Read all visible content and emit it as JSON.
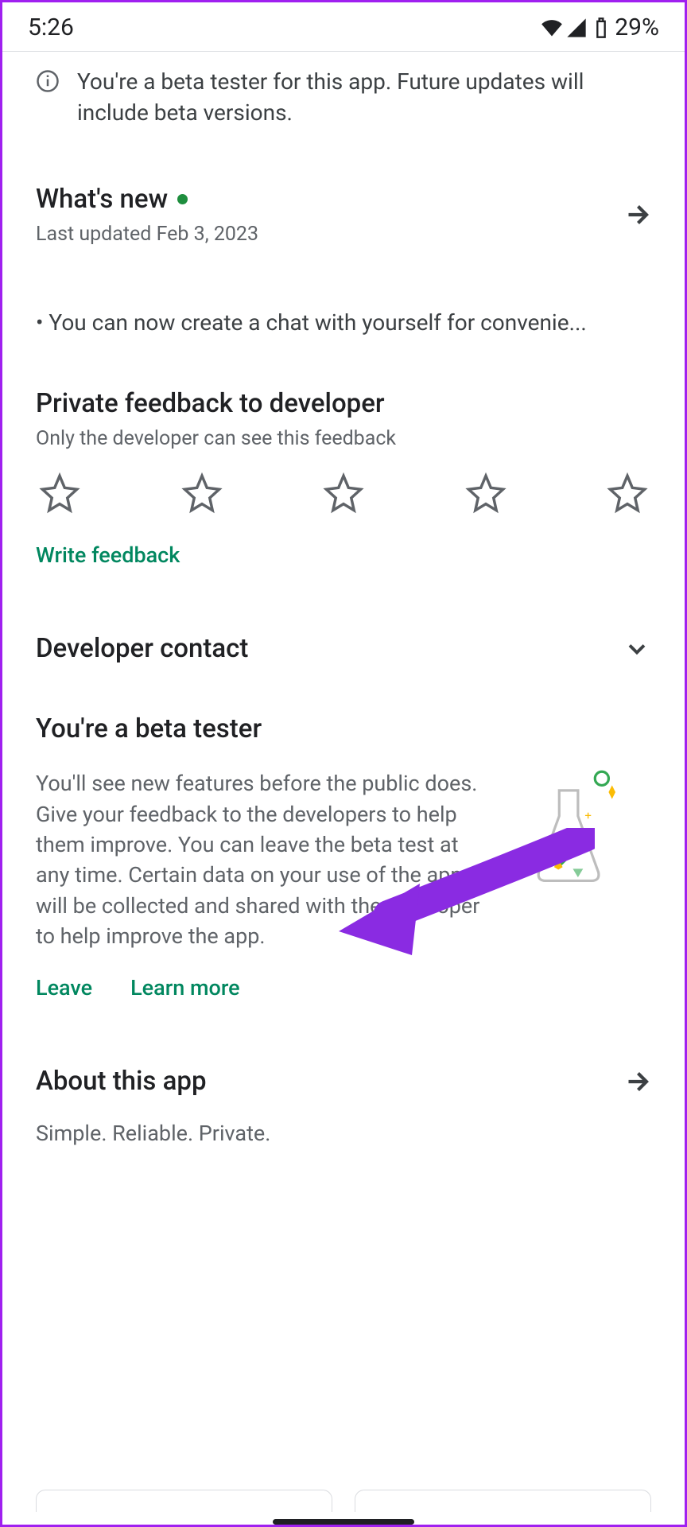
{
  "statusbar": {
    "time": "5:26",
    "battery": "29%"
  },
  "beta_banner": "You're a beta tester for this app. Future updates will include beta versions.",
  "whats_new": {
    "title": "What's new",
    "updated": "Last updated Feb 3, 2023",
    "body": "• You can now create a chat with yourself for convenie..."
  },
  "feedback": {
    "title": "Private feedback to developer",
    "subtitle": "Only the developer can see this feedback",
    "write": "Write feedback"
  },
  "developer_contact": {
    "title": "Developer contact"
  },
  "beta_tester": {
    "title": "You're a beta tester",
    "description": "You'll see new features before the public does. Give your feedback to the developers to help them improve. You can leave the beta test at any time. Certain data on your use of the app will be collected and shared with the developer to help improve the app.",
    "leave": "Leave",
    "learn_more": "Learn more"
  },
  "about": {
    "title": "About this app",
    "description": "Simple. Reliable. Private."
  },
  "colors": {
    "accent": "#01875f",
    "annotation": "#8a2be2"
  }
}
